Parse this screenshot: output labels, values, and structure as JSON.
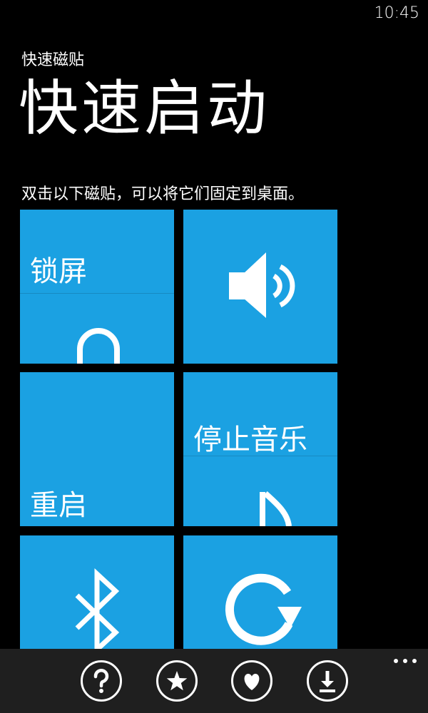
{
  "status": {
    "time": "10:45"
  },
  "header": {
    "app_title": "快速磁贴",
    "page_title": "快速启动"
  },
  "instruction": "双击以下磁贴，可以将它们固定到桌面。",
  "tiles": [
    {
      "label": "锁屏",
      "icon": "lock-icon"
    },
    {
      "label": "",
      "icon": "speaker-volume-icon"
    },
    {
      "label": "重启",
      "icon": ""
    },
    {
      "label": "停止音乐",
      "icon": "music-note-icon"
    },
    {
      "label": "",
      "icon": "bluetooth-icon"
    },
    {
      "label": "",
      "icon": "rotate-icon"
    }
  ],
  "appbar": {
    "buttons": [
      {
        "icon": "help-icon"
      },
      {
        "icon": "star-icon"
      },
      {
        "icon": "heart-icon"
      },
      {
        "icon": "download-icon"
      }
    ],
    "more_icon": "more-dots-icon"
  },
  "colors": {
    "background": "#000000",
    "tile": "#1ba1e2",
    "appbar": "#1f1f1f",
    "text": "#ffffff"
  }
}
